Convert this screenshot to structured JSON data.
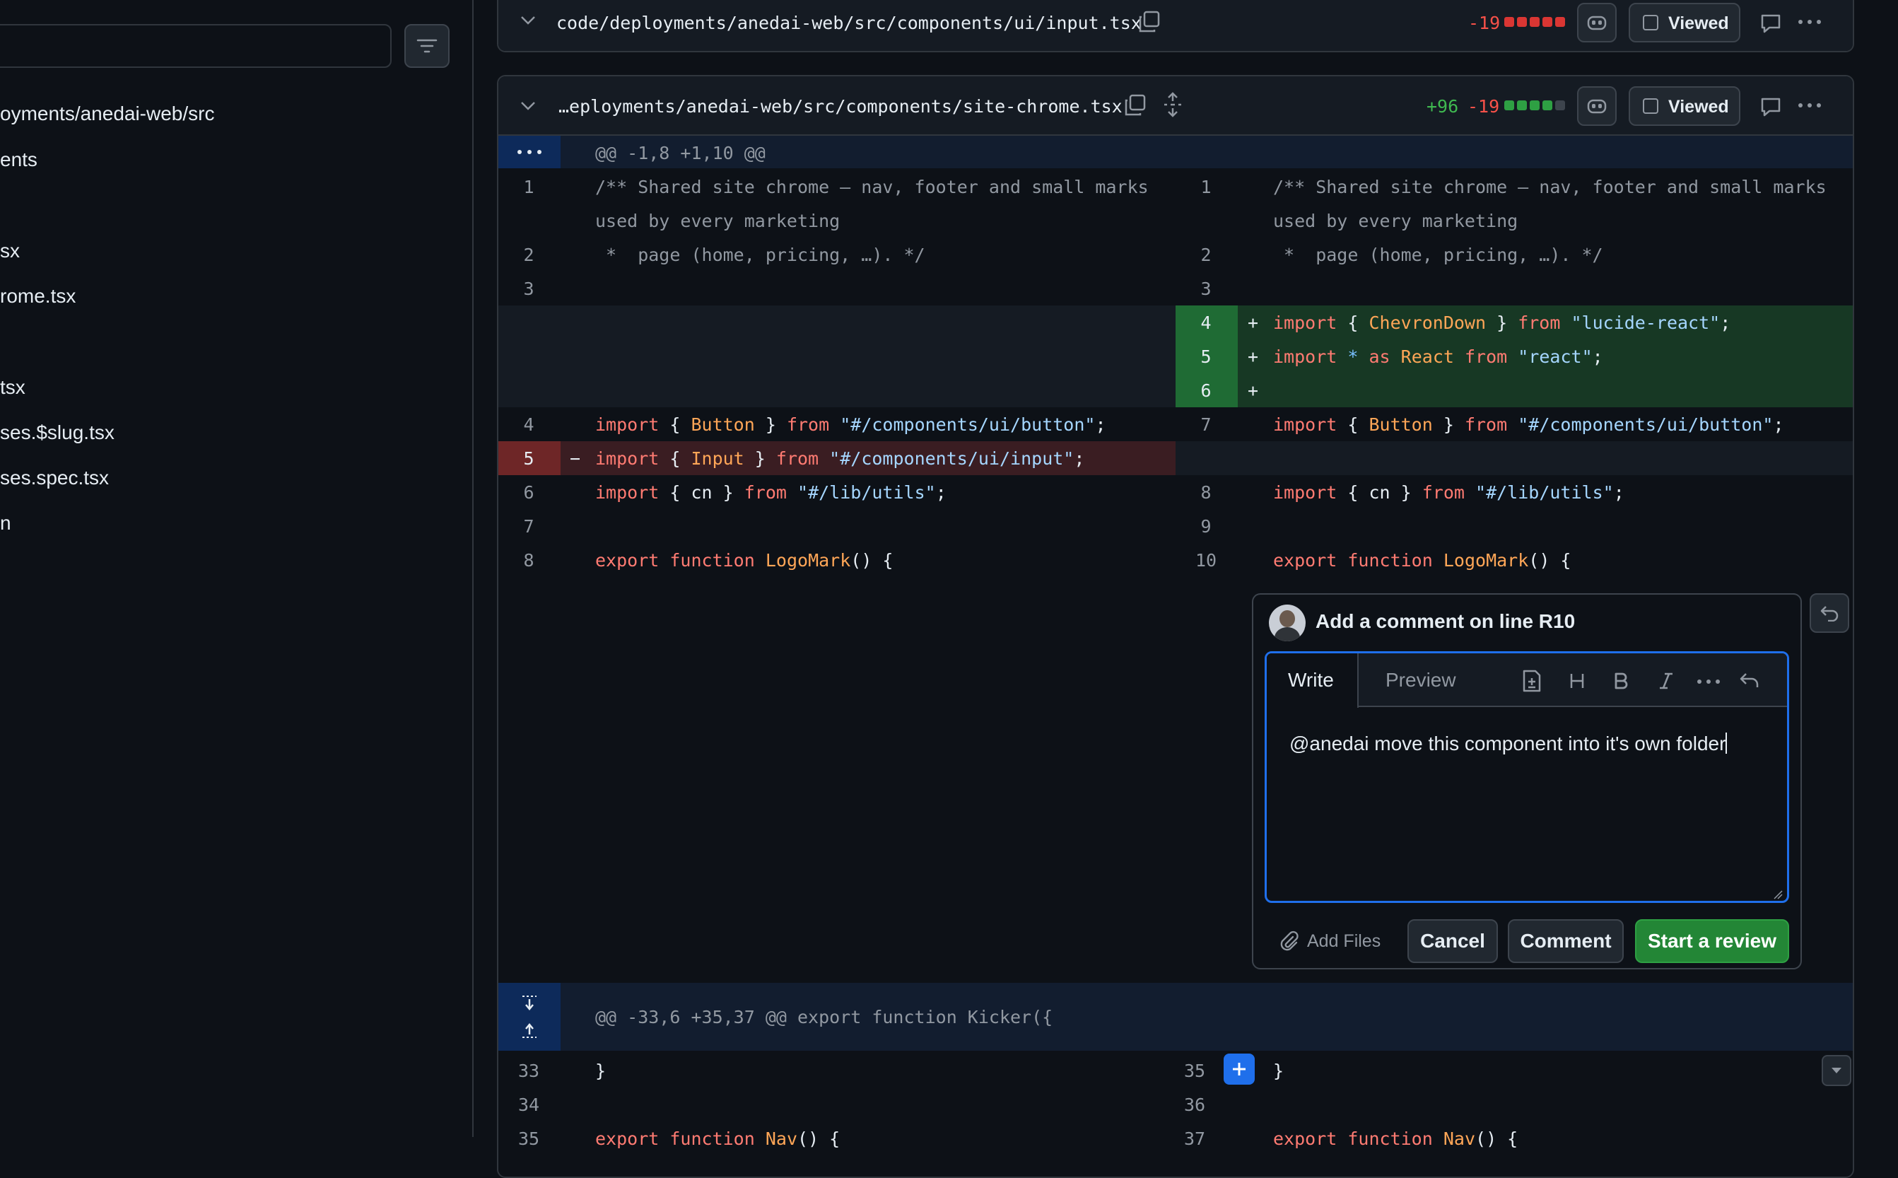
{
  "sidebar": {
    "filter_placeholder": "",
    "items": [
      {
        "label": "oyments/anedai-web/src"
      },
      {
        "label": "ents"
      },
      {
        "label": "sx"
      },
      {
        "label": "rome.tsx"
      },
      {
        "label": "tsx"
      },
      {
        "label": "ses.$slug.tsx"
      },
      {
        "label": "ses.spec.tsx"
      },
      {
        "label": "n"
      }
    ]
  },
  "file1": {
    "path": "code/deployments/anedai-web/src/components/ui/input.tsx",
    "deletions": "-19",
    "viewed_label": "Viewed"
  },
  "file2": {
    "path": "…eployments/anedai-web/src/components/site-chrome.tsx",
    "additions": "+96",
    "deletions": "-19",
    "viewed_label": "Viewed",
    "hunk1": "@@ -1,8 +1,10 @@",
    "hunk2": "@@ -33,6 +35,37 @@ export function Kicker({",
    "comment_line1": "/** Shared site chrome — nav, footer and small marks",
    "comment_line2": "used by every marketing",
    "comment_line3": " *  page (home, pricing, …). */",
    "left_numbers": [
      "1",
      "2",
      "3",
      "4",
      "5",
      "6",
      "7",
      "8",
      "33",
      "34",
      "35"
    ],
    "right_numbers": [
      "1",
      "2",
      "3",
      "4",
      "5",
      "6",
      "7",
      "8",
      "9",
      "10",
      "35",
      "36",
      "37"
    ],
    "add_marker": "+",
    "del_marker": "−",
    "close_brace": "}",
    "code": {
      "import": "import",
      "from": "from",
      "as": "as",
      "star": "*",
      "export": "export",
      "function": "function",
      "chevron": "ChevronDown",
      "lucide": "\"lucide-react\"",
      "react_id": "React",
      "react_str": "\"react\"",
      "button": "Button",
      "button_path": "\"#/components/ui/button\"",
      "input": "Input",
      "input_path": "\"#/components/ui/input\"",
      "cn": "cn",
      "utils_path": "\"#/lib/utils\"",
      "logomark": "LogoMark",
      "nav": "Nav"
    }
  },
  "comment": {
    "title": "Add a comment on line R10",
    "tab_write": "Write",
    "tab_preview": "Preview",
    "text": "@anedai move this component into it's own folder",
    "add_files": "Add Files",
    "cancel": "Cancel",
    "comment_btn": "Comment",
    "start_review": "Start a review"
  },
  "colors": {
    "accent_blue": "#1f6feb",
    "add_green": "#3fb950",
    "del_red": "#f85149",
    "primary_button": "#238636"
  }
}
